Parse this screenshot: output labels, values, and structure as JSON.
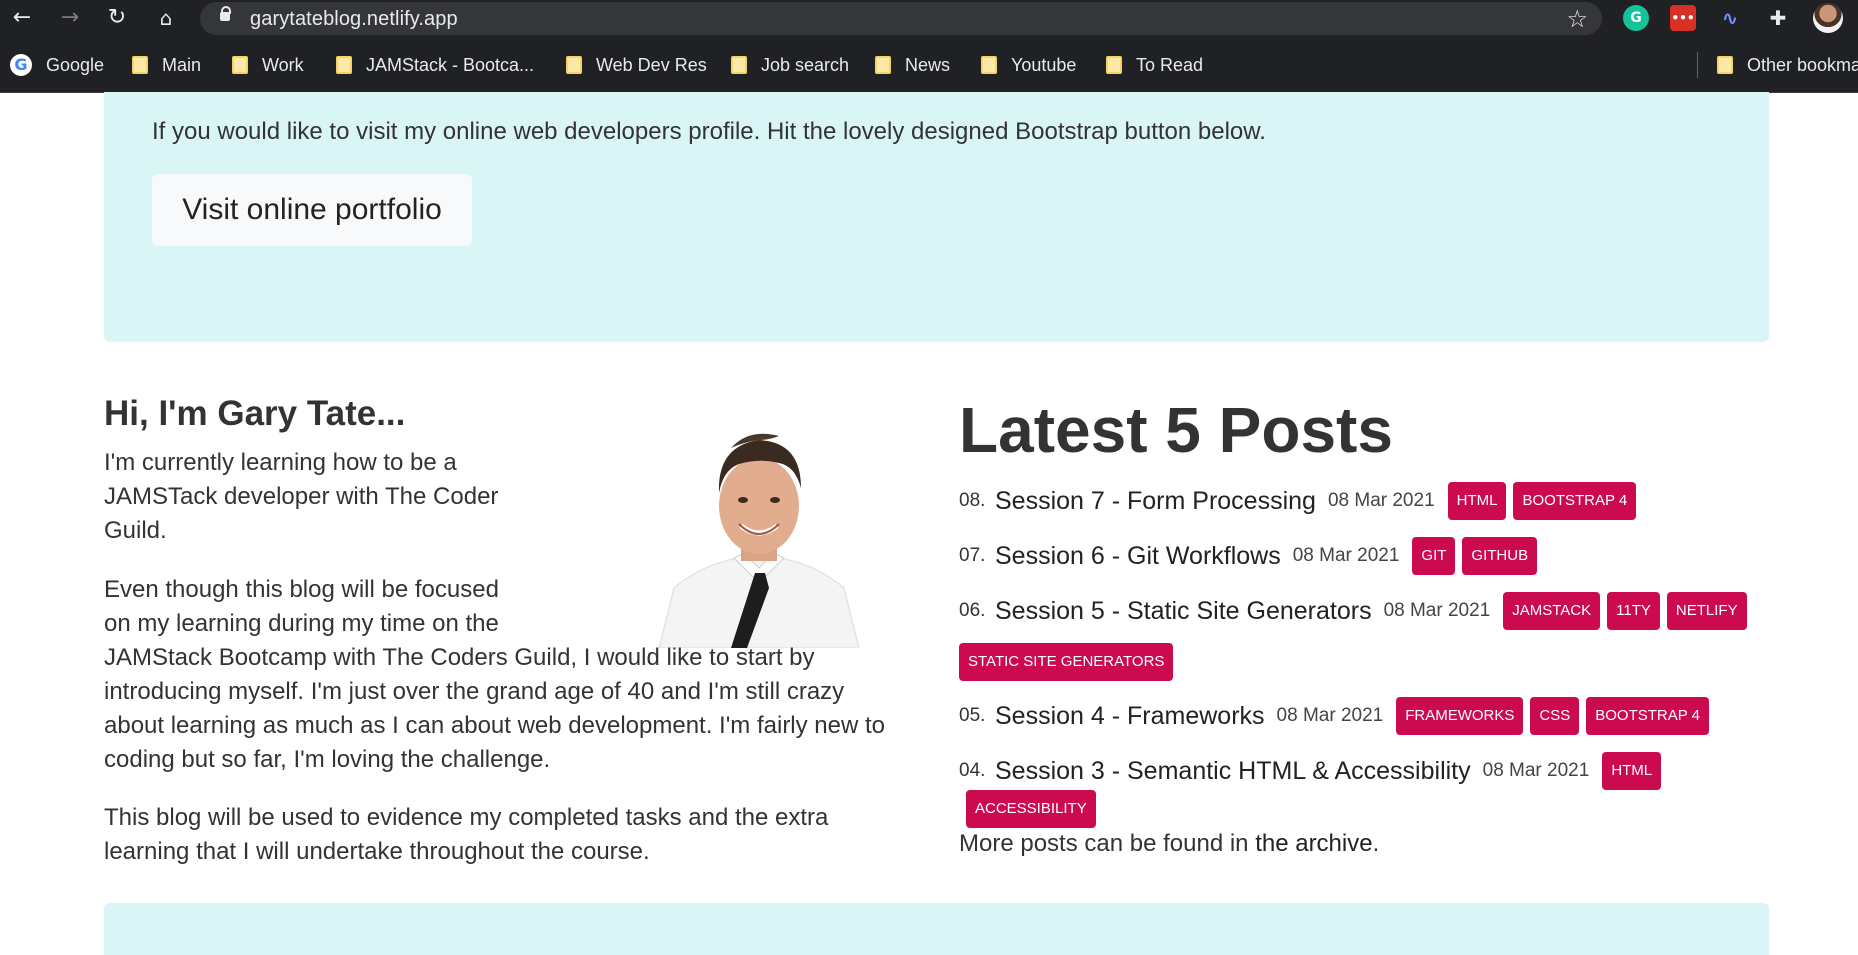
{
  "browser": {
    "url": "garytateblog.netlify.app",
    "bookmarks": [
      "Google",
      "Main",
      "Work",
      "JAMStack - Bootca...",
      "Web Dev Res",
      "Job search",
      "News",
      "Youtube",
      "To Read"
    ],
    "other_bookmarks": "Other bookma",
    "ext_grammarly": "G",
    "ext_red": "•••",
    "ext_wave": "∿",
    "ext_puzzle": "✚"
  },
  "jumbotron": {
    "text": "If you would like to visit my online web developers profile. Hit the lovely designed Bootstrap button below.",
    "button_label": "Visit online portfolio"
  },
  "intro": {
    "heading": "Hi, I'm Gary Tate...",
    "p1": "I'm currently learning how to be a JAMSTack developer with The Coder Guild.",
    "p2_start": "Even though this blog will be focused on my learning during my time on the",
    "p2_rest": "JAMStack Bootcamp with The Coders Guild, I would like to start by introducing myself. I'm just over the grand age of 40 and I'm still crazy about learning as much as I can about web development. I'm fairly new to coding but so far, I'm loving the challenge.",
    "p3": "This blog will be used to evidence my completed tasks and the extra learning that I will undertake throughout the course."
  },
  "posts": {
    "heading": "Latest 5 Posts",
    "items": [
      {
        "num": "08.",
        "title": "Session 7 - Form Processing",
        "date": "08 Mar 2021",
        "tags": [
          "HTML",
          "BOOTSTRAP 4"
        ]
      },
      {
        "num": "07.",
        "title": "Session 6 - Git Workflows",
        "date": "08 Mar 2021",
        "tags": [
          "GIT",
          "GITHUB"
        ]
      },
      {
        "num": "06.",
        "title": "Session 5 - Static Site Generators",
        "date": "08 Mar 2021",
        "tags": [
          "JAMSTACK",
          "11TY",
          "NETLIFY",
          "STATIC SITE GENERATORS"
        ]
      },
      {
        "num": "05.",
        "title": "Session 4 - Frameworks",
        "date": "08 Mar 2021",
        "tags": [
          "FRAMEWORKS",
          "CSS",
          "BOOTSTRAP 4"
        ]
      },
      {
        "num": "04.",
        "title": "Session 3 - Semantic HTML & Accessibility",
        "date": "08 Mar 2021",
        "tags": [
          "HTML",
          "ACCESSIBILITY"
        ]
      }
    ],
    "more_prefix": "More posts can be found in ",
    "more_link": "the archive",
    "more_suffix": "."
  },
  "colors": {
    "tag": "#cc0a4f",
    "jumbotron": "#d9f5f5",
    "chrome": "#202124"
  }
}
